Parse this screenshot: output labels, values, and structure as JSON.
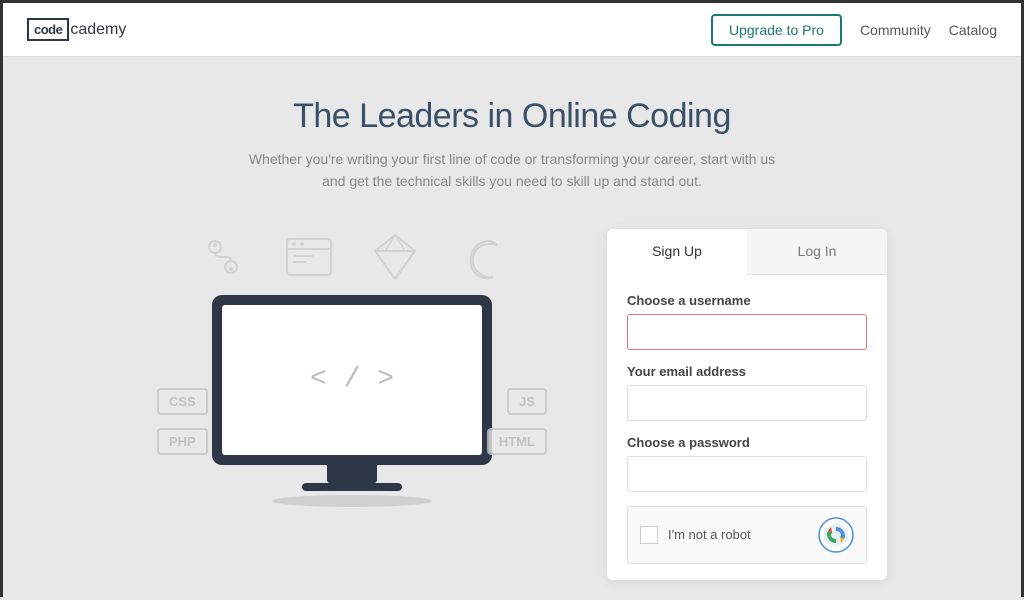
{
  "header": {
    "logo_code": "code",
    "logo_suffix": "cademy",
    "upgrade_label": "Upgrade to Pro",
    "community_label": "Community",
    "catalog_label": "Catalog"
  },
  "hero": {
    "title": "The Leaders in Online Coding",
    "subtitle_line1": "Whether you're writing your first line of code or transforming your career, start with us",
    "subtitle_line2": "and get the technical skills you need to skill up and stand out."
  },
  "illustration": {
    "code_text": "< / >",
    "tags": [
      "CSS",
      "PHP",
      "JS",
      "HTML"
    ]
  },
  "form": {
    "tab_signup": "Sign Up",
    "tab_login": "Log In",
    "username_label": "Choose a username",
    "email_label": "Your email address",
    "password_label": "Choose a password",
    "captcha_label": "I'm not a robot",
    "username_placeholder": "",
    "email_placeholder": "",
    "password_placeholder": ""
  }
}
